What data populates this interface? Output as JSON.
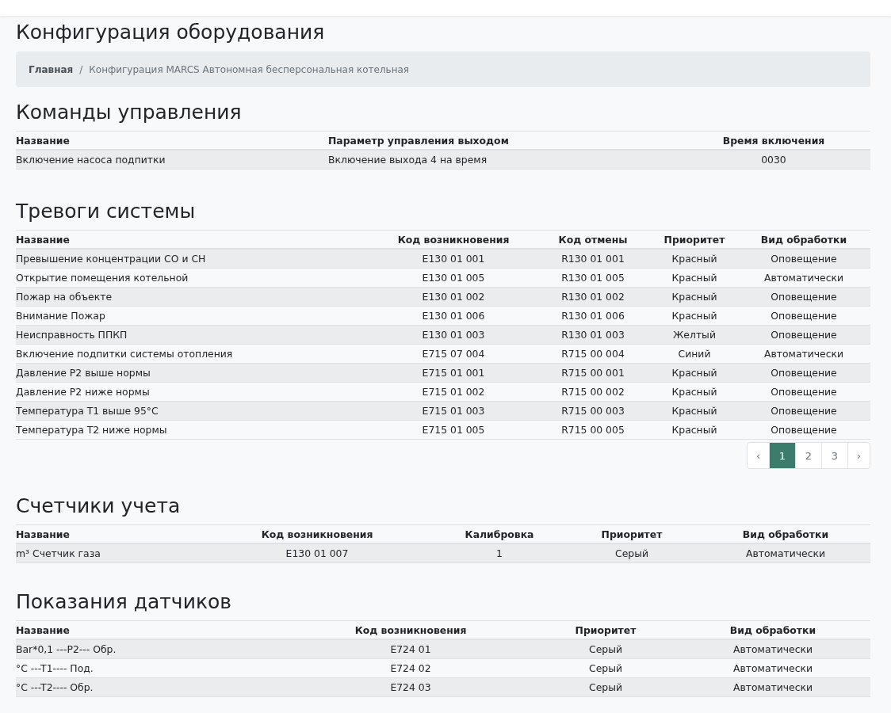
{
  "page": {
    "title": "Конфигурация оборудования"
  },
  "breadcrumb": {
    "separator": "/",
    "items": [
      {
        "label": "Главная",
        "current": false
      },
      {
        "label": "Конфигурация MARCS Автономная бесперсональная котельная",
        "current": true
      }
    ]
  },
  "sections": [
    {
      "title": "Команды управления",
      "columns": [
        "Название",
        "Параметр управления выходом",
        "Время включения"
      ],
      "rows": [
        [
          "Включение насоса подпитки",
          "Включение выхода 4 на время",
          "0030"
        ]
      ]
    },
    {
      "title": "Тревоги системы",
      "columns": [
        "Название",
        "Код возникновения",
        "Код отмены",
        "Приоритет",
        "Вид обработки"
      ],
      "rows": [
        [
          "Превышение концентрации CO и CH",
          "E130 01 001",
          "R130 01 001",
          "Красный",
          "Оповещение"
        ],
        [
          "Открытие помещения котельной",
          "E130 01 005",
          "R130 01 005",
          "Красный",
          "Автоматически"
        ],
        [
          "Пожар на объекте",
          "E130 01 002",
          "R130 01 002",
          "Красный",
          "Оповещение"
        ],
        [
          "Внимание Пожар",
          "E130 01 006",
          "R130 01 006",
          "Красный",
          "Оповещение"
        ],
        [
          "Неисправность ППКП",
          "E130 01 003",
          "R130 01 003",
          "Желтый",
          "Оповещение"
        ],
        [
          "Включение подпитки системы отопления",
          "E715 07 004",
          "R715 00 004",
          "Синий",
          "Автоматически"
        ],
        [
          "Давление P2 выше нормы",
          "E715 01 001",
          "R715 00 001",
          "Красный",
          "Оповещение"
        ],
        [
          "Давление P2 ниже нормы",
          "E715 01 002",
          "R715 00 002",
          "Красный",
          "Оповещение"
        ],
        [
          "Температура T1 выше 95°C",
          "E715 01 003",
          "R715 00 003",
          "Красный",
          "Оповещение"
        ],
        [
          "Температура T2 ниже нормы",
          "E715 01 005",
          "R715 00 005",
          "Красный",
          "Оповещение"
        ]
      ],
      "pagination": [
        {
          "label": "‹",
          "selected": false
        },
        {
          "label": "1",
          "selected": true
        },
        {
          "label": "2",
          "selected": false
        },
        {
          "label": "3",
          "selected": false
        },
        {
          "label": "›",
          "selected": false
        }
      ]
    },
    {
      "title": "Счетчики учета",
      "columns": [
        "Название",
        "Код возникновения",
        "Калибровка",
        "Приоритет",
        "Вид обработки"
      ],
      "rows": [
        [
          "m³ Счетчик газа",
          "E130 01 007",
          "1",
          "Серый",
          "Автоматически"
        ]
      ]
    },
    {
      "title": "Показания датчиков",
      "columns": [
        "Название",
        "Код возникновения",
        "Приоритет",
        "Вид обработки"
      ],
      "rows": [
        [
          "Bar*0,1 ---P2--- Обр.",
          "E724 01",
          "Серый",
          "Автоматически"
        ],
        [
          "°C ---T1---- Под.",
          "E724 02",
          "Серый",
          "Автоматически"
        ],
        [
          "°C ---T2---- Обр.",
          "E724 03",
          "Серый",
          "Автоматически"
        ]
      ]
    }
  ]
}
